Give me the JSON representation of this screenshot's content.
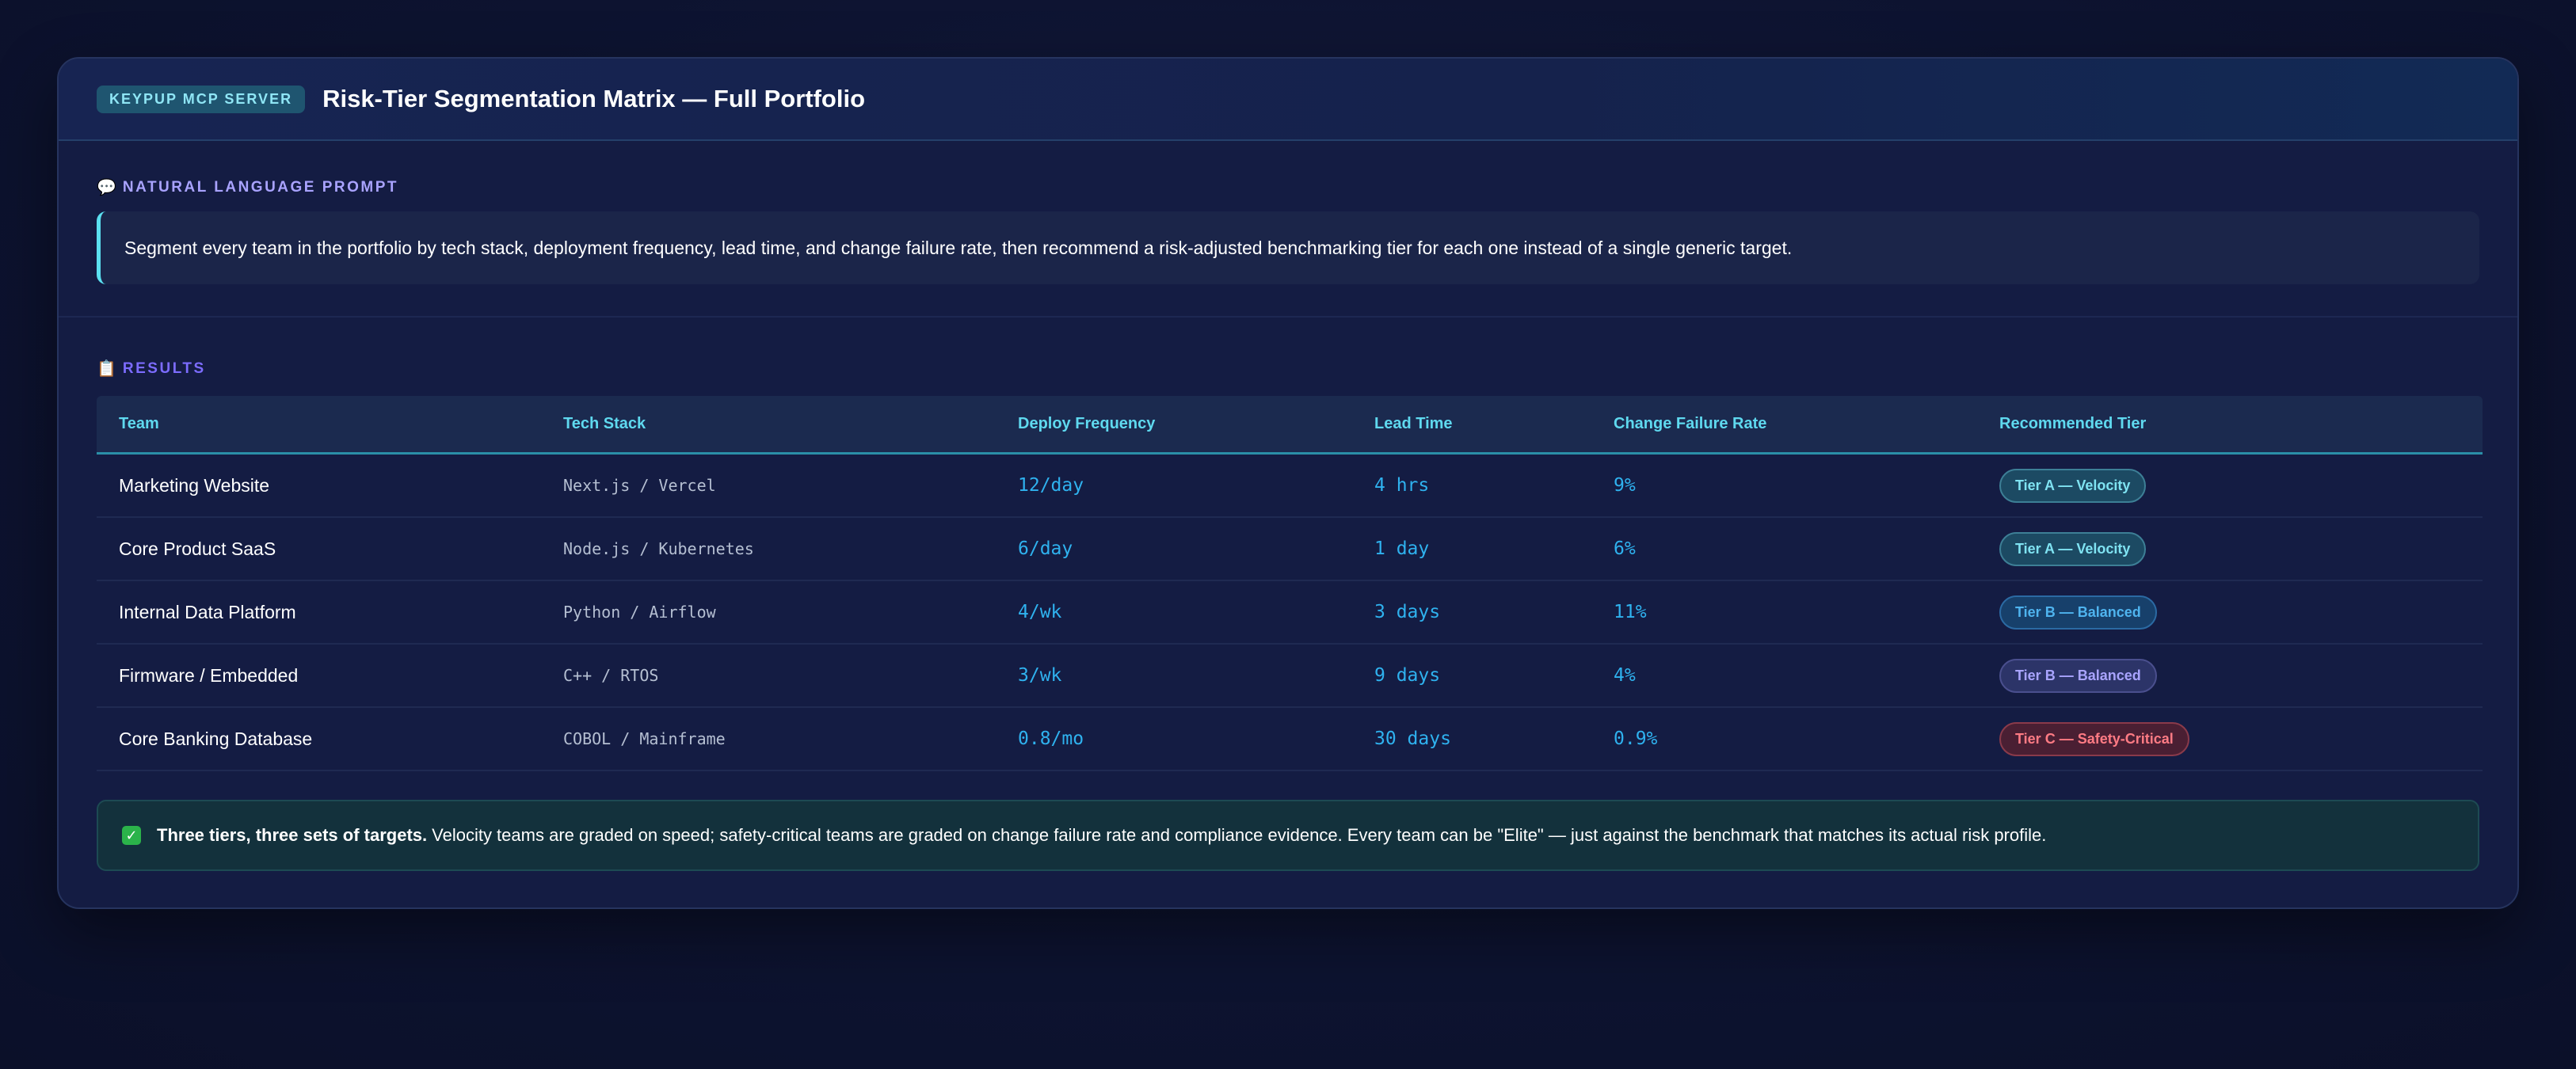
{
  "header": {
    "badge": "KEYPUP MCP SERVER",
    "title": "Risk-Tier Segmentation Matrix — Full Portfolio"
  },
  "prompt": {
    "icon": "speech-bubble-icon",
    "label": "NATURAL LANGUAGE PROMPT",
    "text": "Segment every team in the portfolio by tech stack, deployment frequency, lead time, and change failure rate, then recommend a risk-adjusted benchmarking tier for each one instead of a single generic target."
  },
  "results": {
    "icon": "clipboard-icon",
    "label": "RESULTS",
    "columns": [
      "Team",
      "Tech Stack",
      "Deploy Frequency",
      "Lead Time",
      "Change Failure Rate",
      "Recommended Tier"
    ],
    "rows": [
      {
        "team": "Marketing Website",
        "stack": "Next.js / Vercel",
        "deploy": "12/day",
        "lead": "4 hrs",
        "cfr": "9%",
        "tier": "Tier A — Velocity"
      },
      {
        "team": "Core Product SaaS",
        "stack": "Node.js / Kubernetes",
        "deploy": "6/day",
        "lead": "1 day",
        "cfr": "6%",
        "tier": "Tier A — Velocity"
      },
      {
        "team": "Internal Data Platform",
        "stack": "Python / Airflow",
        "deploy": "4/wk",
        "lead": "3 days",
        "cfr": "11%",
        "tier": "Tier B — Balanced"
      },
      {
        "team": "Firmware / Embedded",
        "stack": "C++ / RTOS",
        "deploy": "3/wk",
        "lead": "9 days",
        "cfr": "4%",
        "tier": "Tier B — Balanced"
      },
      {
        "team": "Core Banking Database",
        "stack": "COBOL / Mainframe",
        "deploy": "0.8/mo",
        "lead": "30 days",
        "cfr": "0.9%",
        "tier": "Tier C — Safety-Critical"
      }
    ]
  },
  "summary": {
    "icon": "check-icon",
    "bold": "Three tiers, three sets of targets.",
    "text": "Velocity teams are graded on speed; safety-critical teams are graded on change failure rate and compliance evidence. Every team can be \"Elite\" — just against the benchmark that matches its actual risk profile."
  },
  "colors": {
    "accent_cyan": "#5fd9ef",
    "metric_blue": "#2fb2ef",
    "tier_a": "#7fe3f2",
    "tier_b": "#4fb4ef",
    "tier_b_alt": "#a9a4ff",
    "tier_c": "#ff7b84",
    "success": "#2bb34a"
  }
}
